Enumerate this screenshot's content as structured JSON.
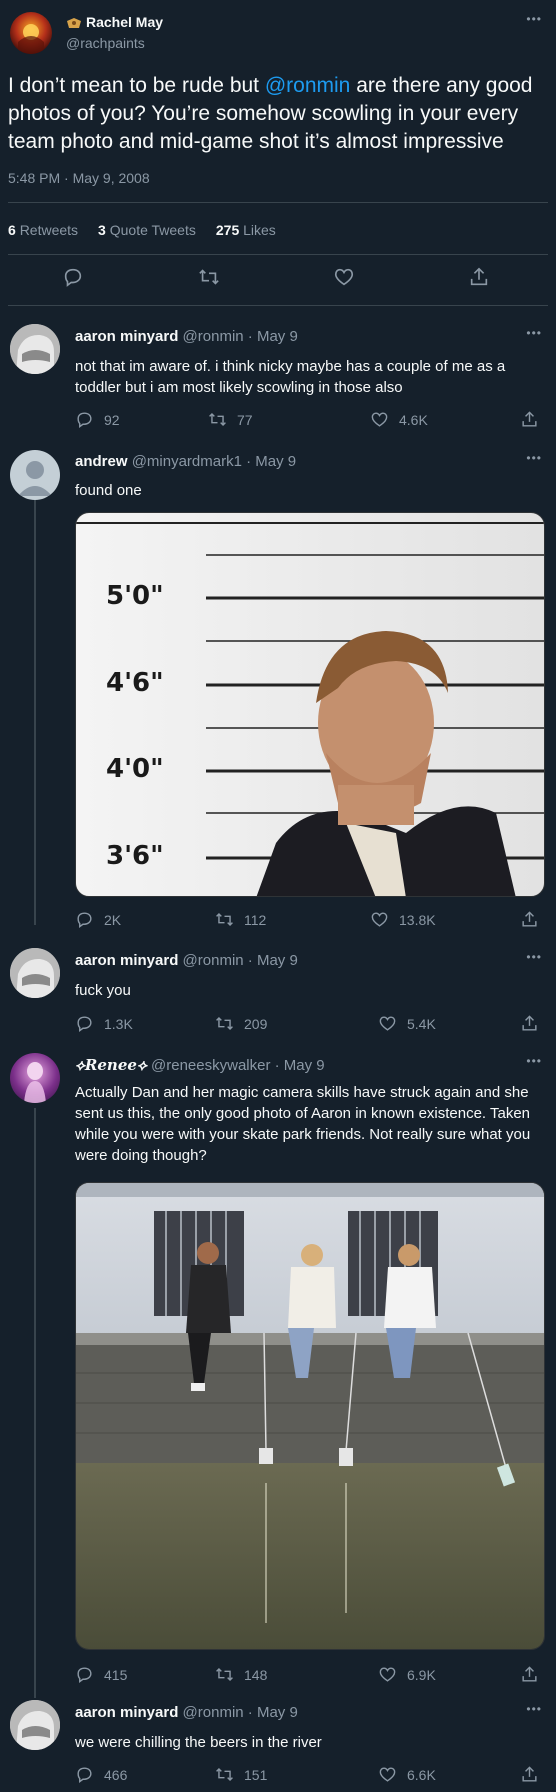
{
  "main_tweet": {
    "author_name": "Rachel May",
    "author_handle": "@rachpaints",
    "text_before": "I don’t mean to be rude but ",
    "mention": "@ronmin",
    "text_after": " are there any good photos of you? You’re somehow scowling in your every team photo and mid-game shot it’s almost impressive",
    "timestamp": "5:48 PM · May 9, 2008",
    "retweets_count": "6",
    "retweets_label": "Retweets",
    "quotes_count": "3",
    "quotes_label": "Quote Tweets",
    "likes_count": "275",
    "likes_label": "Likes"
  },
  "replies": [
    {
      "author_name": "aaron minyard",
      "author_handle": "@ronmin",
      "date": "May 9",
      "text": "not that im aware of. i think nicky maybe has a couple of me as a toddler but i am most likely scowling in those also",
      "reply_count": "92",
      "retweet_count": "77",
      "like_count": "4.6K"
    },
    {
      "author_name": "andrew",
      "author_handle": "@minyardmark1",
      "date": "May 9",
      "text": "found one",
      "reply_count": "2K",
      "retweet_count": "112",
      "like_count": "13.8K",
      "height_labels": [
        "5'0\"",
        "4'6\"",
        "4'0\"",
        "3'6\""
      ]
    },
    {
      "author_name": "aaron minyard",
      "author_handle": "@ronmin",
      "date": "May 9",
      "text": "fuck you",
      "reply_count": "1.3K",
      "retweet_count": "209",
      "like_count": "5.4K"
    },
    {
      "author_name": "⟡𝑹𝒆𝒏𝒆𝒆⟡",
      "author_handle": "@reneeskywalker",
      "date": "May 9",
      "text": "Actually Dan and her magic camera skills have struck again and she sent us this, the only good photo of Aaron in known existence. Taken while you were with your skate park friends. Not really sure what you were doing though?",
      "reply_count": "415",
      "retweet_count": "148",
      "like_count": "6.9K"
    },
    {
      "author_name": "aaron minyard",
      "author_handle": "@ronmin",
      "date": "May 9",
      "text": "we were chilling the beers in the river",
      "reply_count": "466",
      "retweet_count": "151",
      "like_count": "6.6K"
    }
  ],
  "colors": {
    "background": "#15202b",
    "text": "#f7f9f9",
    "muted": "#8b98a5",
    "link": "#1d9bf0",
    "divider": "#38444d"
  },
  "icons": [
    "reply-icon",
    "retweet-icon",
    "like-icon",
    "share-icon",
    "more-icon",
    "shield-emoji-icon"
  ]
}
